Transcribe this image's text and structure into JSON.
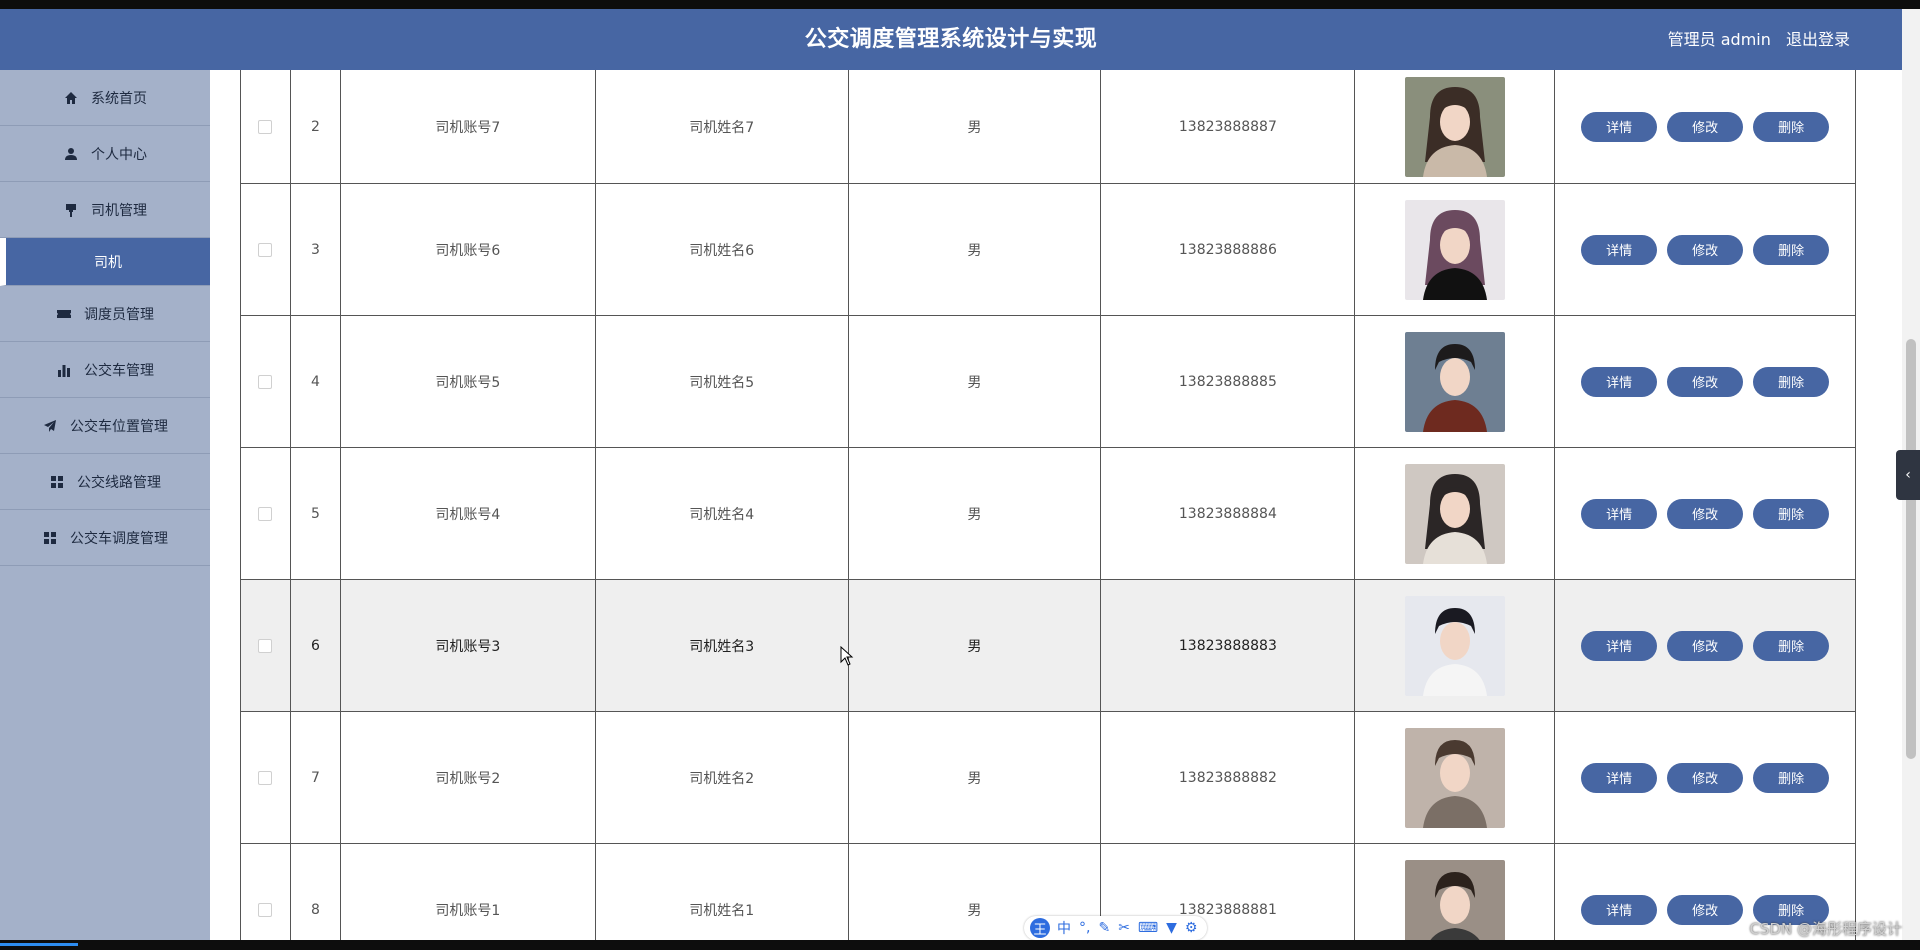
{
  "header": {
    "title": "公交调度管理系统设计与实现",
    "user_role_label": "管理员 admin",
    "logout_label": "退出登录"
  },
  "sidebar": {
    "items": [
      {
        "label": "系统首页",
        "icon": "home-icon"
      },
      {
        "label": "个人中心",
        "icon": "user-icon"
      },
      {
        "label": "司机管理",
        "icon": "brush-icon"
      },
      {
        "label": "司机",
        "icon": "",
        "active": true
      },
      {
        "label": "调度员管理",
        "icon": "ticket-icon"
      },
      {
        "label": "公交车管理",
        "icon": "bar-chart-icon"
      },
      {
        "label": "公交车位置管理",
        "icon": "paper-plane-icon"
      },
      {
        "label": "公交线路管理",
        "icon": "grid-icon"
      },
      {
        "label": "公交车调度管理",
        "icon": "grid-icon"
      }
    ]
  },
  "table": {
    "rows": [
      {
        "index": "2",
        "account": "司机账号7",
        "name": "司机姓名7",
        "gender": "男",
        "phone": "13823888887",
        "photo": "female-portrait"
      },
      {
        "index": "3",
        "account": "司机账号6",
        "name": "司机姓名6",
        "gender": "男",
        "phone": "13823888886",
        "photo": "female-portrait"
      },
      {
        "index": "4",
        "account": "司机账号5",
        "name": "司机姓名5",
        "gender": "男",
        "phone": "13823888885",
        "photo": "male-portrait"
      },
      {
        "index": "5",
        "account": "司机账号4",
        "name": "司机姓名4",
        "gender": "男",
        "phone": "13823888884",
        "photo": "female-portrait"
      },
      {
        "index": "6",
        "account": "司机账号3",
        "name": "司机姓名3",
        "gender": "男",
        "phone": "13823888883",
        "photo": "male-portrait"
      },
      {
        "index": "7",
        "account": "司机账号2",
        "name": "司机姓名2",
        "gender": "男",
        "phone": "13823888882",
        "photo": "male-portrait"
      },
      {
        "index": "8",
        "account": "司机账号1",
        "name": "司机姓名1",
        "gender": "男",
        "phone": "13823888881",
        "photo": "male-portrait"
      }
    ],
    "actions": {
      "detail": "详情",
      "edit": "修改",
      "delete": "删除"
    }
  },
  "ime_toolbar": {
    "logo": "王",
    "mode": "中"
  },
  "watermark": "CSDN @海彤程序设计",
  "colors": {
    "primary": "#4766a3",
    "sidebar_bg": "#a4b1c9",
    "hover_row": "#efefef"
  }
}
